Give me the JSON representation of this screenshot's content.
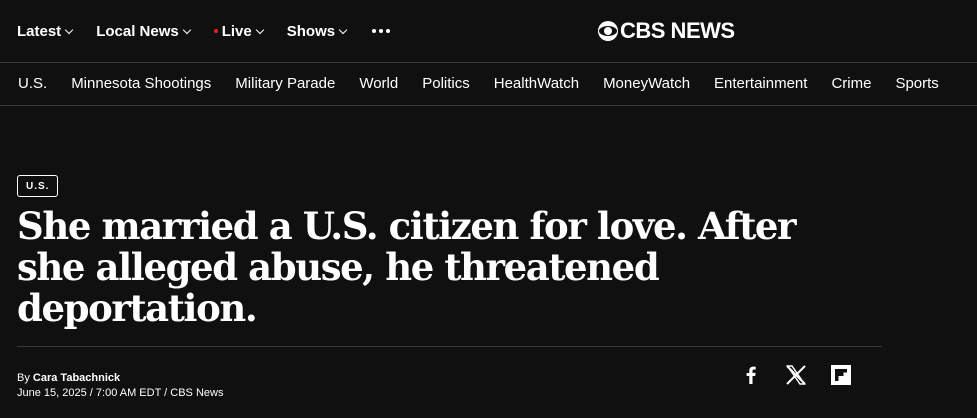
{
  "header": {
    "nav": [
      {
        "label": "Latest",
        "live": false
      },
      {
        "label": "Local News",
        "live": false
      },
      {
        "label": "Live",
        "live": true
      },
      {
        "label": "Shows",
        "live": false
      }
    ],
    "logo_text": "CBS NEWS"
  },
  "sections": [
    "U.S.",
    "Minnesota Shootings",
    "Military Parade",
    "World",
    "Politics",
    "HealthWatch",
    "MoneyWatch",
    "Entertainment",
    "Crime",
    "Sports"
  ],
  "article": {
    "tag": "U.S.",
    "headline": "She married a U.S. citizen for love. After she alleged abuse, he threatened deportation.",
    "by_prefix": "By ",
    "author": "Cara Tabachnick",
    "dateline": "June 15, 2025 / 7:00 AM EDT / CBS News"
  },
  "share_icons": [
    "facebook-icon",
    "x-icon",
    "flipboard-icon"
  ],
  "colors": {
    "background": "#101010",
    "live_dot": "#e0202a",
    "divider": "#3a3a3a"
  }
}
